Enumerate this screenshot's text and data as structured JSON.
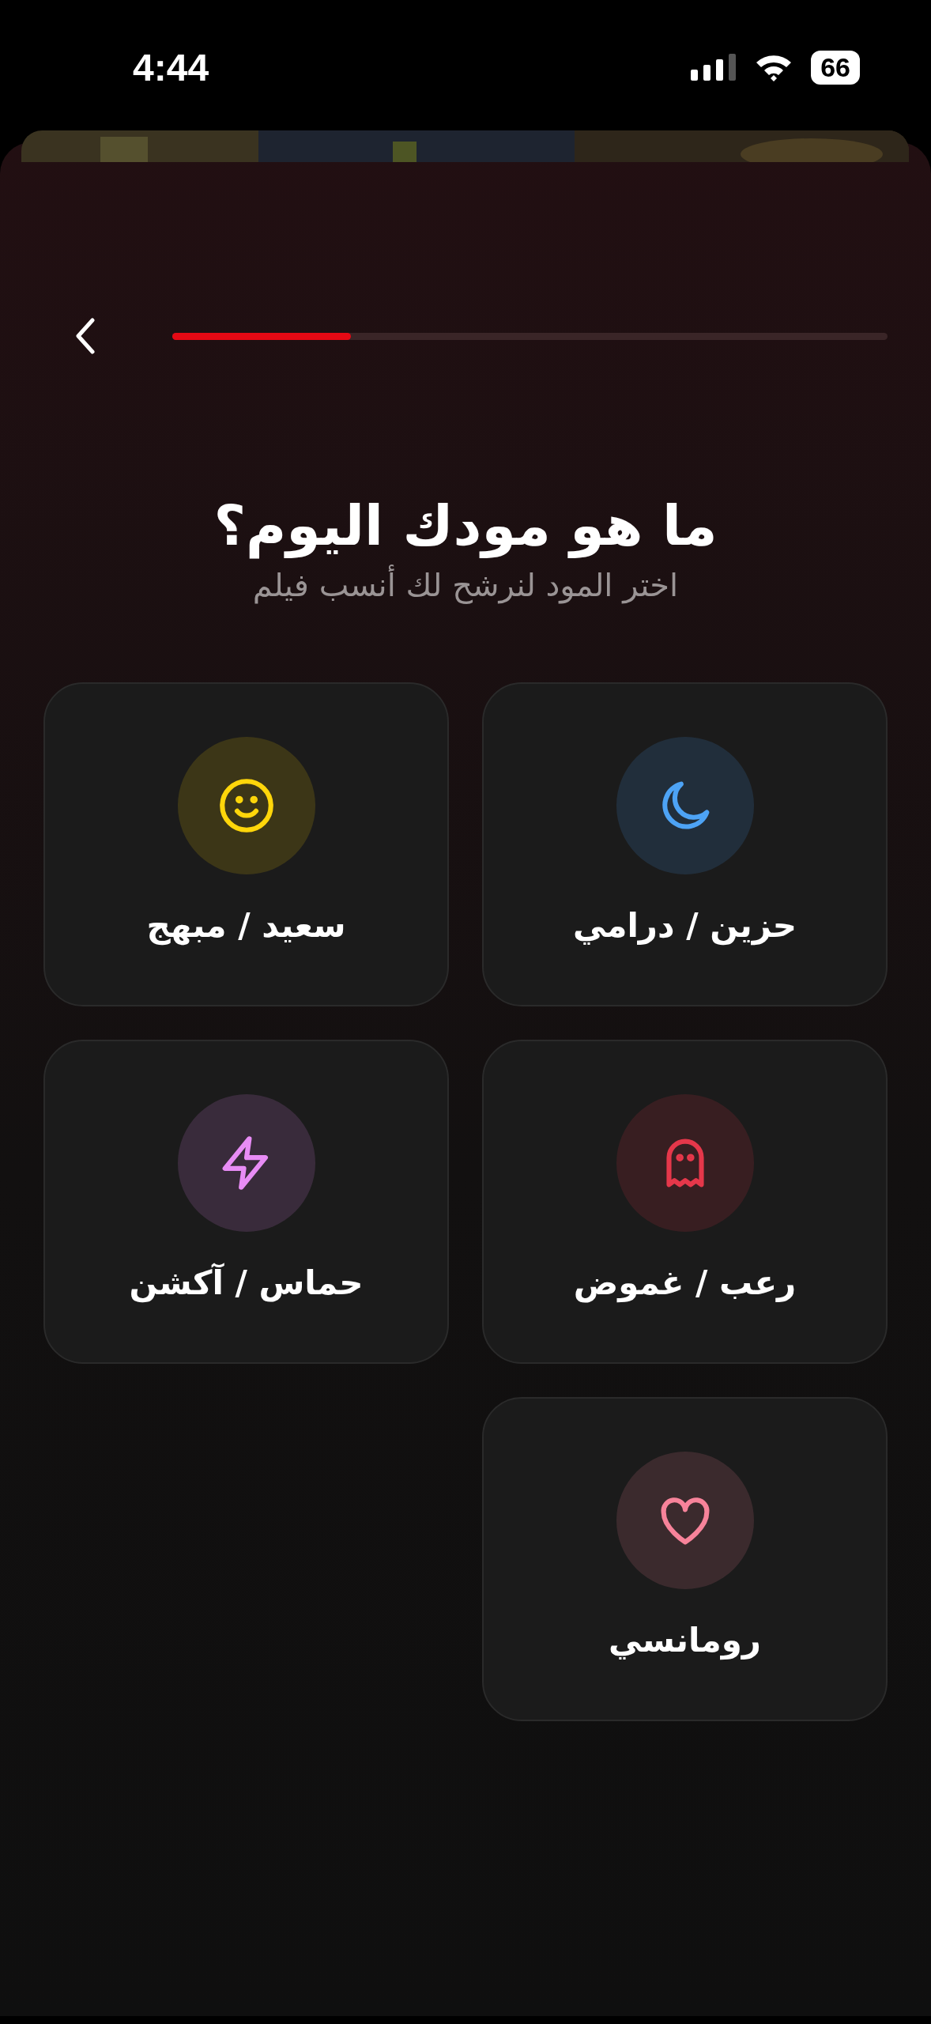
{
  "status_bar": {
    "time": "4:44",
    "battery": "66"
  },
  "header": {
    "progress": {
      "level": 0.25
    }
  },
  "title": "ما هو مودك اليوم؟",
  "subtitle": "اختر المود لنرشح لك أنسب فيلم",
  "moods": [
    {
      "label": "حزين / درامي",
      "kind": "moon",
      "color": "#4da3f5"
    },
    {
      "label": "سعيد / مبهج",
      "kind": "smile",
      "color": "#ffd60a"
    },
    {
      "label": "رعب / غموض",
      "kind": "ghost",
      "color": "#e5374a"
    },
    {
      "label": "حماس / آكشن",
      "kind": "bolt",
      "color": "#e88cf5"
    },
    {
      "label": "رومانسي",
      "kind": "heart",
      "color": "#f7839a"
    }
  ]
}
